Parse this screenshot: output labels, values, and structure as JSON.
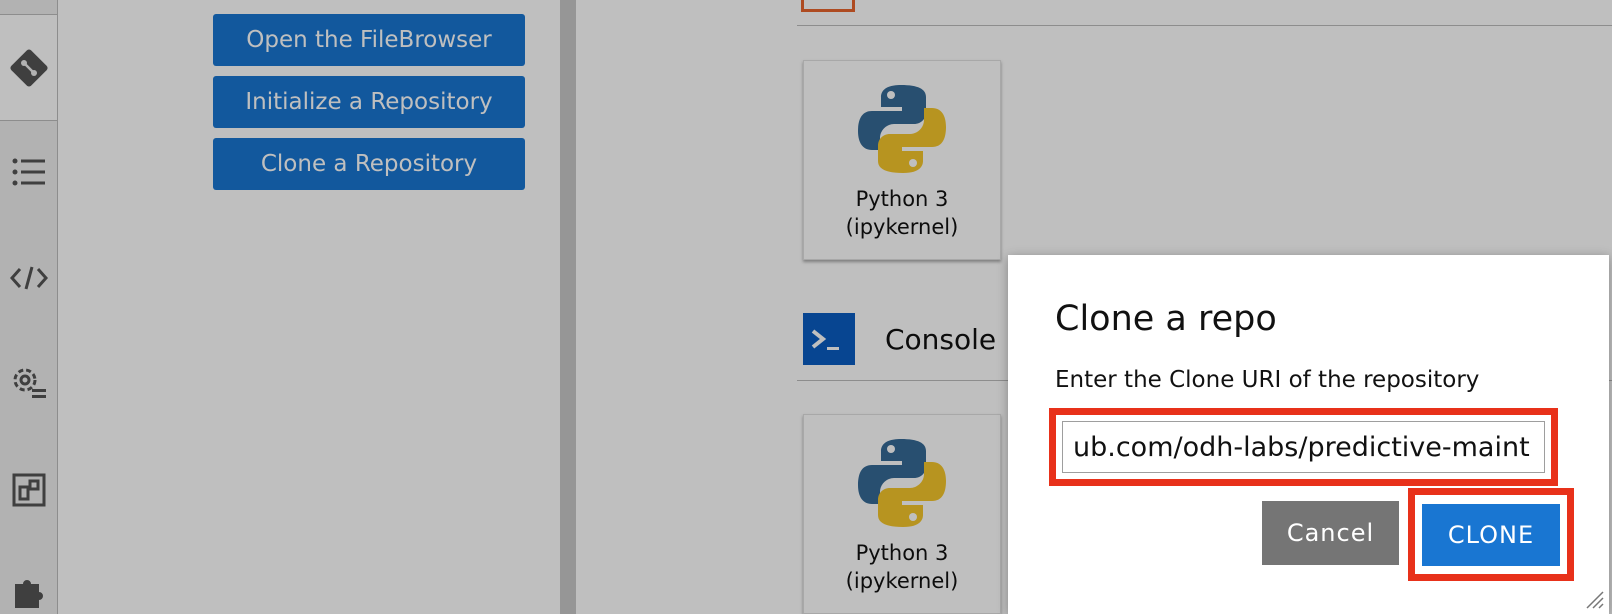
{
  "git_panel": {
    "buttons": [
      {
        "label": "Open the FileBrowser"
      },
      {
        "label": "Initialize a Repository"
      },
      {
        "label": "Clone a Repository"
      }
    ]
  },
  "launcher": {
    "kernel_card_label": "Python 3\n(ipykernel)",
    "console_section_title": "Console"
  },
  "dialog": {
    "title": "Clone a repo",
    "prompt": "Enter the Clone URI of the repository",
    "url_value": "ub.com/odh-labs/predictive-maint",
    "cancel_label": "Cancel",
    "clone_label": "CLONE"
  },
  "colors": {
    "accent_blue": "#1976d2",
    "highlight_red": "#e8311a",
    "cancel_gray": "#757575"
  },
  "icons": [
    "git-icon",
    "table-of-contents-icon",
    "property-inspector-icon",
    "settings-list-icon",
    "extension-manager-icon",
    "puzzle-icon",
    "python-logo-icon",
    "console-prompt-icon"
  ]
}
